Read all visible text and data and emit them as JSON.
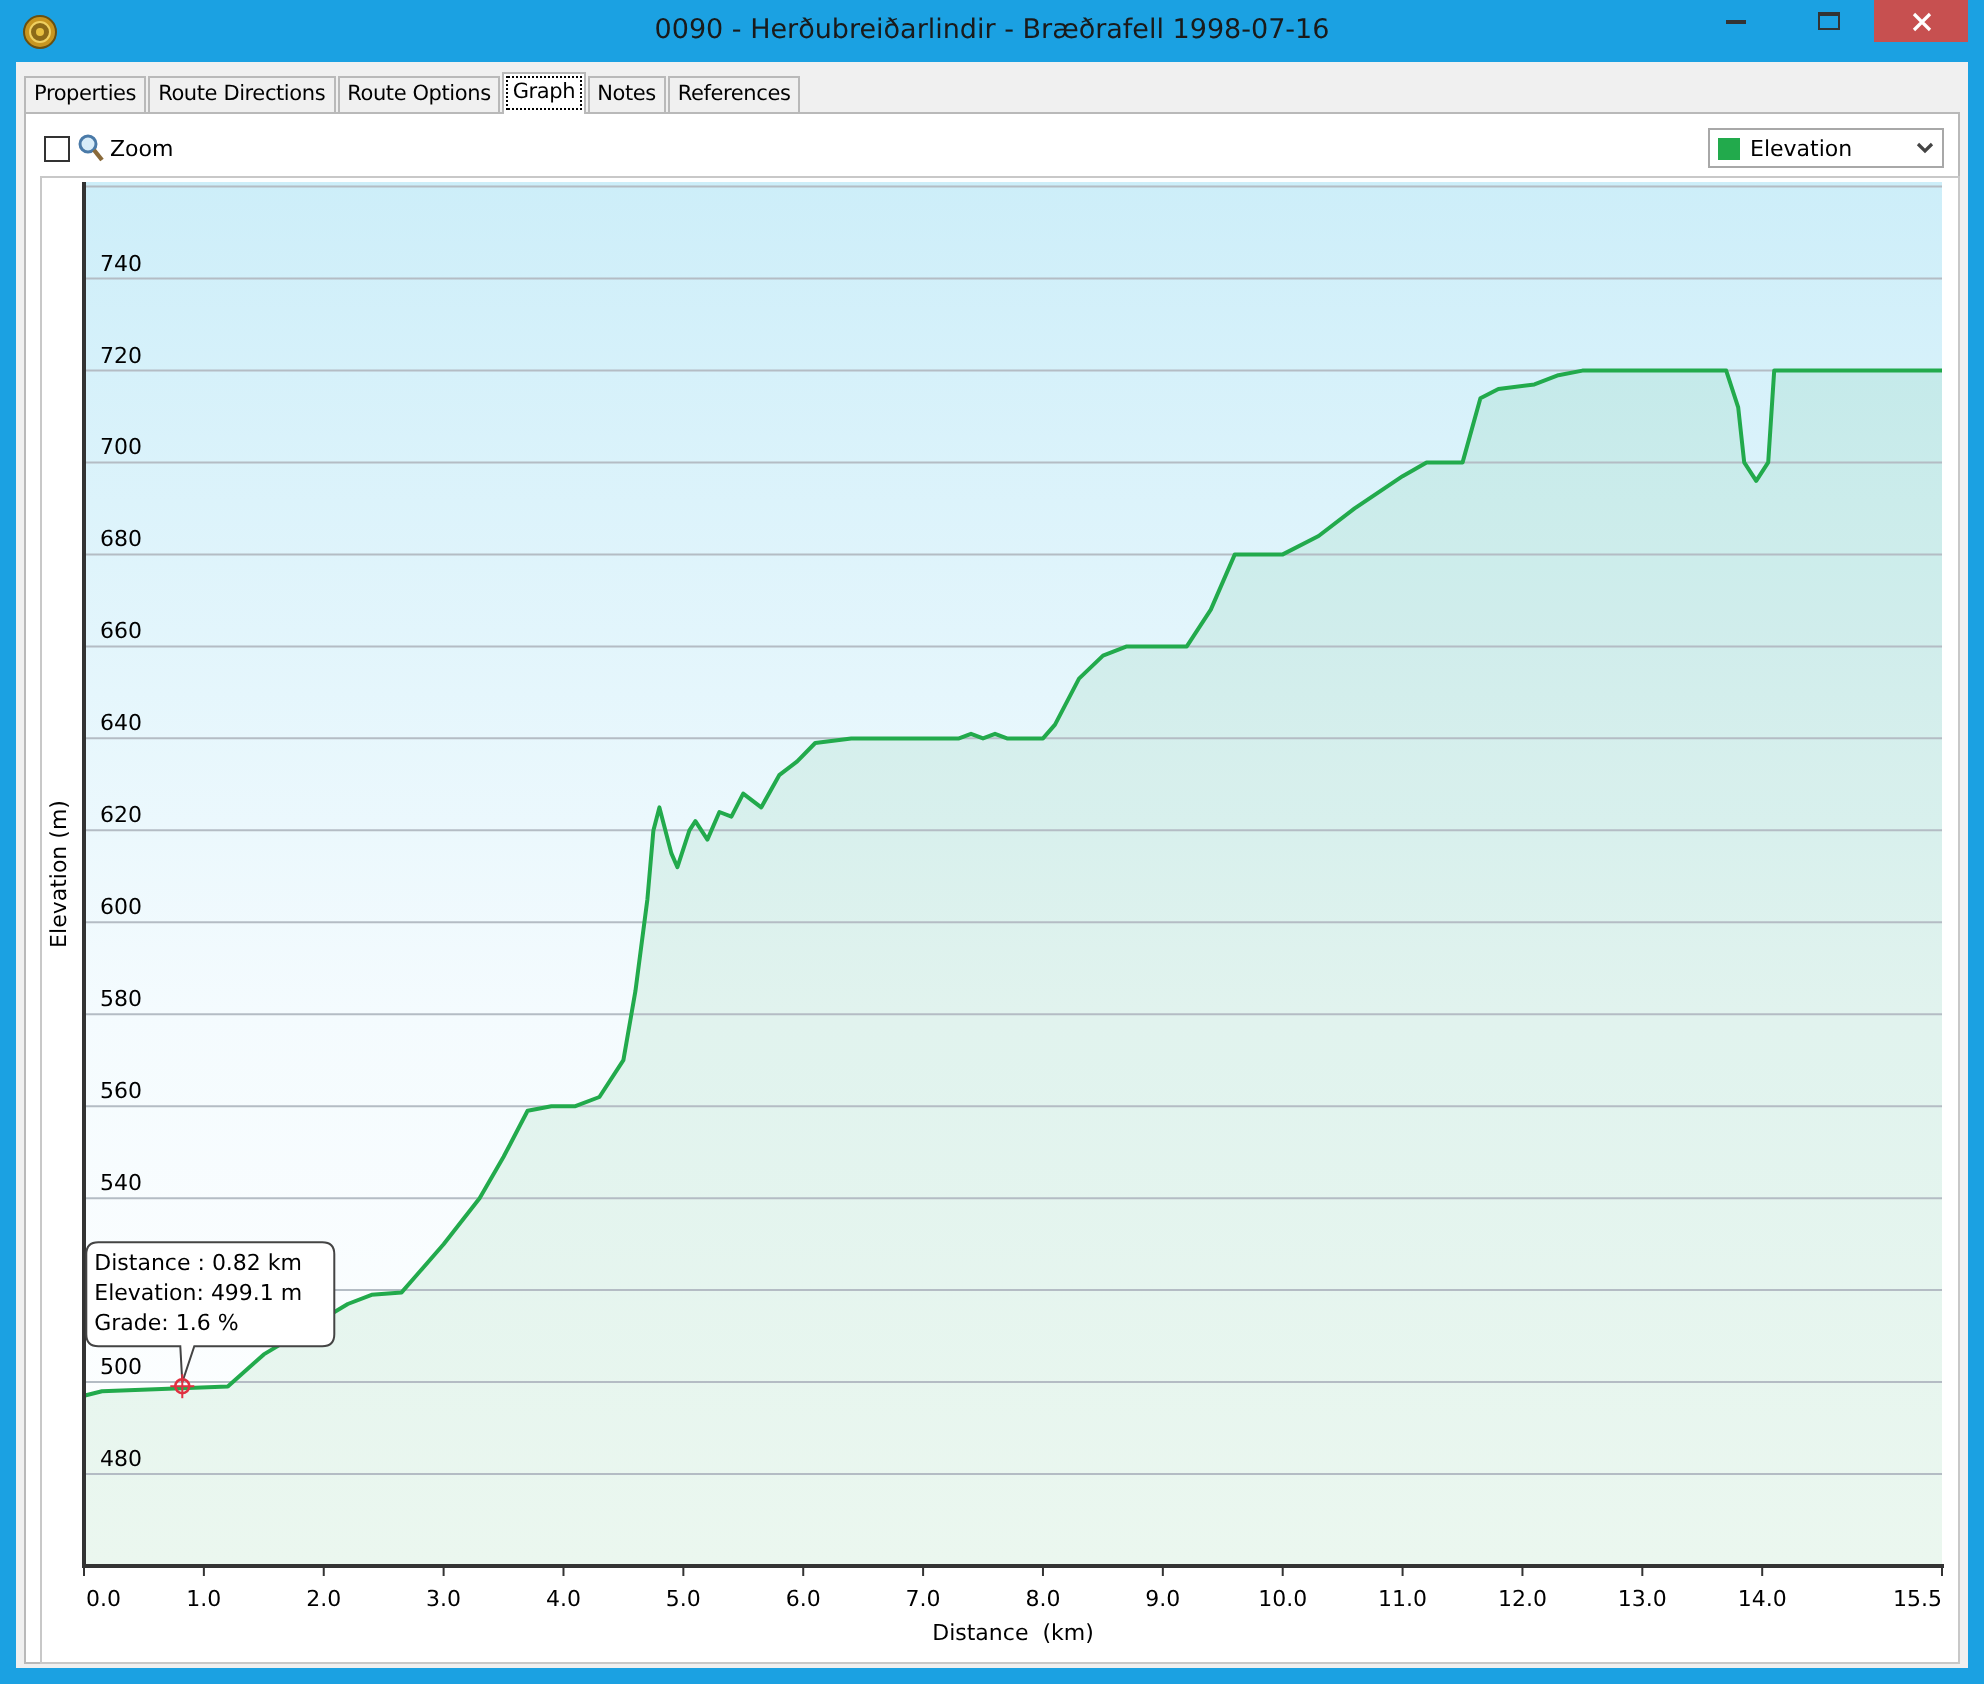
{
  "window": {
    "title": "0090 - Herðubreiðarlindir - Bræðrafell 1998-07-16"
  },
  "tabs": [
    {
      "label": "Properties",
      "selected": false
    },
    {
      "label": "Route Directions",
      "selected": false
    },
    {
      "label": "Route Options",
      "selected": false
    },
    {
      "label": "Graph",
      "selected": true
    },
    {
      "label": "Notes",
      "selected": false
    },
    {
      "label": "References",
      "selected": false
    }
  ],
  "graph": {
    "zoom": {
      "label": "Zoom",
      "checked": false
    },
    "chart_data": {
      "type": "area",
      "grid": true,
      "xlabel": "Distance  (km)",
      "ylabel": "Elevation (m)",
      "x": [
        0,
        0.15,
        1.2,
        1.5,
        2.2,
        2.4,
        2.65,
        2.8,
        3.0,
        3.3,
        3.5,
        3.7,
        3.9,
        4.1,
        4.3,
        4.5,
        4.6,
        4.7,
        4.75,
        4.8,
        4.9,
        4.95,
        5.05,
        5.1,
        5.2,
        5.3,
        5.4,
        5.5,
        5.65,
        5.8,
        5.95,
        6.1,
        6.4,
        7.3,
        7.4,
        7.5,
        7.6,
        7.7,
        8.0,
        8.1,
        8.3,
        8.5,
        8.7,
        9.2,
        9.4,
        9.6,
        10.0,
        10.3,
        10.6,
        11.0,
        11.2,
        11.5,
        11.65,
        11.8,
        12.1,
        12.3,
        12.5,
        13.7,
        13.8,
        13.85,
        13.95,
        14.05,
        14.1,
        15.5
      ],
      "series": [
        {
          "name": "Elevation",
          "color": "#22aa4c",
          "values": [
            497,
            498,
            499,
            506,
            517,
            519,
            519.5,
            524,
            530,
            540,
            549,
            559,
            560,
            560,
            562,
            570,
            585,
            605,
            620,
            625,
            615,
            612,
            620,
            622,
            618,
            624,
            623,
            628,
            625,
            632,
            635,
            639,
            640,
            640,
            641,
            640,
            641,
            640,
            640,
            643,
            653,
            658,
            660,
            660,
            668,
            680,
            680,
            684,
            690,
            697,
            700,
            700,
            714,
            716,
            717,
            719,
            720,
            720,
            712,
            700,
            696,
            700,
            720,
            720
          ]
        }
      ],
      "xlim": [
        0,
        15.5
      ],
      "ylim": [
        460,
        761
      ],
      "xticks": [
        {
          "value": 0,
          "label": "0.0"
        },
        {
          "value": 1,
          "label": "1.0"
        },
        {
          "value": 2,
          "label": "2.0"
        },
        {
          "value": 3,
          "label": "3.0"
        },
        {
          "value": 4,
          "label": "4.0"
        },
        {
          "value": 5,
          "label": "5.0"
        },
        {
          "value": 6,
          "label": "6.0"
        },
        {
          "value": 7,
          "label": "7.0"
        },
        {
          "value": 8,
          "label": "8.0"
        },
        {
          "value": 9,
          "label": "9.0"
        },
        {
          "value": 10,
          "label": "10.0"
        },
        {
          "value": 11,
          "label": "11.0"
        },
        {
          "value": 12,
          "label": "12.0"
        },
        {
          "value": 13,
          "label": "13.0"
        },
        {
          "value": 14,
          "label": "14.0"
        },
        {
          "value": 15.5,
          "label": "15.5"
        }
      ],
      "yticks": [
        480,
        500,
        540,
        560,
        580,
        600,
        620,
        640,
        660,
        680,
        700,
        720,
        740
      ],
      "annotations": [
        {
          "x": 0.82,
          "y": 499.1,
          "text": "Distance : 0.82 km\nElevation: 499.1 m\nGrade: 1.6 %"
        }
      ]
    }
  }
}
